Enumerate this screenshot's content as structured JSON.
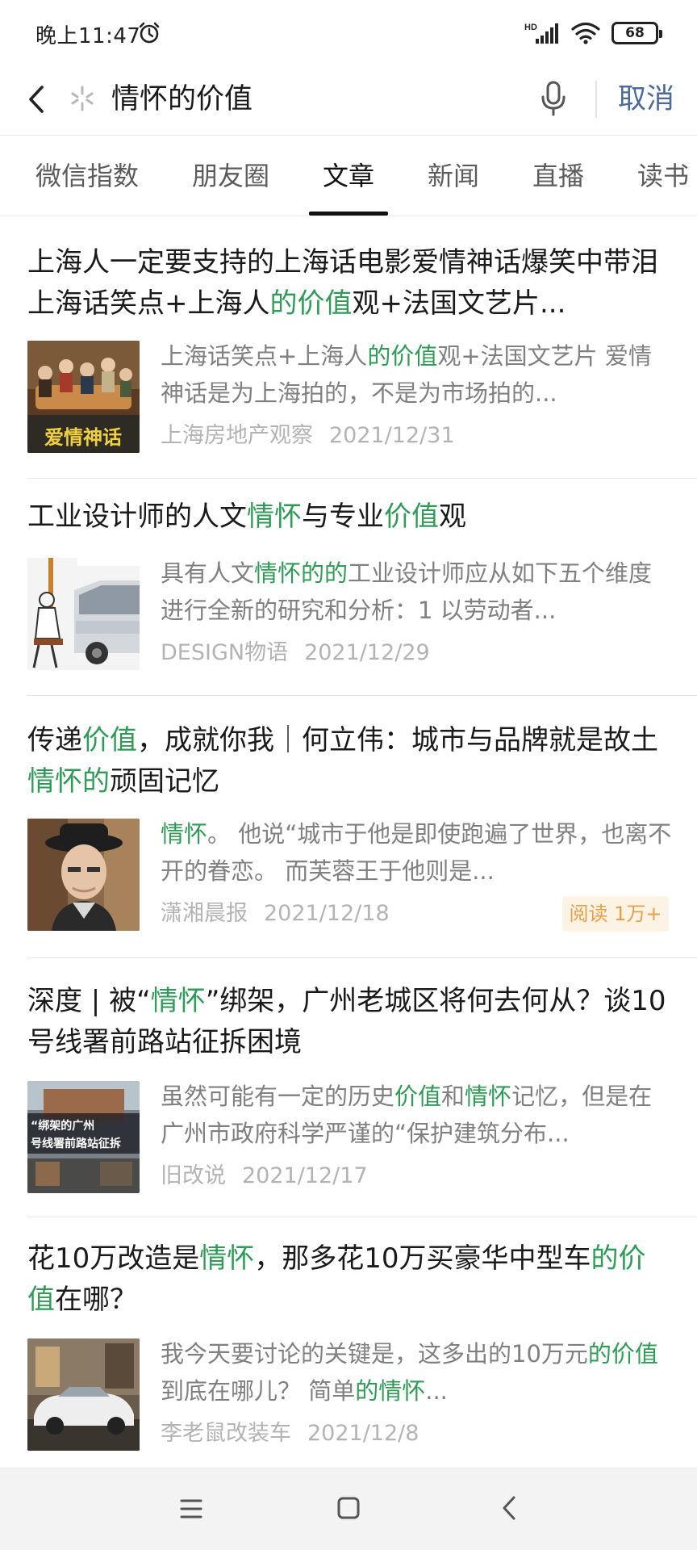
{
  "status_bar": {
    "time": "晚上11:47",
    "network": "HD",
    "battery": "68",
    "icons": [
      "alarm-icon",
      "signal-icon",
      "wifi-icon",
      "battery-icon"
    ]
  },
  "search": {
    "query": "情怀的价值",
    "cancel_label": "取消",
    "icons": [
      "back-icon",
      "search-logo-icon",
      "mic-icon"
    ]
  },
  "tabs": [
    {
      "label": "微信指数",
      "active": false
    },
    {
      "label": "朋友圈",
      "active": false
    },
    {
      "label": "文章",
      "active": true
    },
    {
      "label": "新闻",
      "active": false
    },
    {
      "label": "直播",
      "active": false
    },
    {
      "label": "读书",
      "active": false
    }
  ],
  "articles": [
    {
      "title": [
        {
          "t": "上海人一定要支持的上海话电影爱情神话爆笑中带泪上海话笑点+上海人",
          "hl": false
        },
        {
          "t": "的价值",
          "hl": true
        },
        {
          "t": "观+法国文艺片...",
          "hl": false
        }
      ],
      "snippet": [
        {
          "t": "上海话笑点+上海人",
          "hl": false
        },
        {
          "t": "的价值",
          "hl": true
        },
        {
          "t": "观+法国文艺片 爱情神话是为上海拍的，不是为市场拍的...",
          "hl": false
        }
      ],
      "source": "上海房地产观察",
      "date": "2021/12/31",
      "thumb_text": "爱情神话",
      "read": ""
    },
    {
      "title": [
        {
          "t": "工业设计师的人文",
          "hl": false
        },
        {
          "t": "情怀",
          "hl": true
        },
        {
          "t": "与专业",
          "hl": false
        },
        {
          "t": "价值",
          "hl": true
        },
        {
          "t": "观",
          "hl": false
        }
      ],
      "snippet": [
        {
          "t": "具有人文",
          "hl": false
        },
        {
          "t": "情怀的的",
          "hl": true
        },
        {
          "t": "工业设计师应从如下五个维度进行全新的研究和分析：1 以劳动者...",
          "hl": false
        }
      ],
      "source": "DESIGN物语",
      "date": "2021/12/29",
      "thumb_text": "",
      "read": ""
    },
    {
      "title": [
        {
          "t": "传递",
          "hl": false
        },
        {
          "t": "价值",
          "hl": true
        },
        {
          "t": "，成就你我｜何立伟：城市与品牌就是故土",
          "hl": false
        },
        {
          "t": "情怀的",
          "hl": true
        },
        {
          "t": "顽固记忆",
          "hl": false
        }
      ],
      "snippet": [
        {
          "t": "情怀",
          "hl": true
        },
        {
          "t": "。 他说“城市于他是即使跑遍了世界，也离不开的眷恋。 而芙蓉王于他则是...",
          "hl": false
        }
      ],
      "source": "潇湘晨报",
      "date": "2021/12/18",
      "thumb_text": "",
      "read": "阅读 1万+"
    },
    {
      "title": [
        {
          "t": "深度 | 被“",
          "hl": false
        },
        {
          "t": "情怀",
          "hl": true
        },
        {
          "t": "”绑架，广州老城区将何去何从？谈10号线署前路站征拆困境",
          "hl": false
        }
      ],
      "snippet": [
        {
          "t": "虽然可能有一定的历史",
          "hl": false
        },
        {
          "t": "价值",
          "hl": true
        },
        {
          "t": "和",
          "hl": false
        },
        {
          "t": "情怀",
          "hl": true
        },
        {
          "t": "记忆，但是在广州市政府科学严谨的“保护建筑分布...",
          "hl": false
        }
      ],
      "source": "旧改说",
      "date": "2021/12/17",
      "thumb_text": "“绑架的广州 号线署前路站征拆",
      "read": ""
    },
    {
      "title": [
        {
          "t": "花10万改造是",
          "hl": false
        },
        {
          "t": "情怀",
          "hl": true
        },
        {
          "t": "，那多花10万买豪华中型车",
          "hl": false
        },
        {
          "t": "的价值",
          "hl": true
        },
        {
          "t": "在哪？",
          "hl": false
        }
      ],
      "snippet": [
        {
          "t": "我今天要讨论的关键是，这多出的10万元",
          "hl": false
        },
        {
          "t": "的价值",
          "hl": true
        },
        {
          "t": "到底在哪儿？ 简单",
          "hl": false
        },
        {
          "t": "的情怀",
          "hl": true
        },
        {
          "t": "...",
          "hl": false
        }
      ],
      "source": "李老鼠改装车",
      "date": "2021/12/8",
      "thumb_text": "",
      "read": ""
    }
  ],
  "nav_bar": {
    "icons": [
      "menu-icon",
      "home-icon",
      "back-icon"
    ]
  },
  "colors": {
    "highlight": "#2f9b57",
    "cancel": "#4d6a96",
    "meta": "#b3b3b3",
    "read_badge_bg": "#fdf3e5",
    "read_badge_text": "#e6a04a"
  }
}
